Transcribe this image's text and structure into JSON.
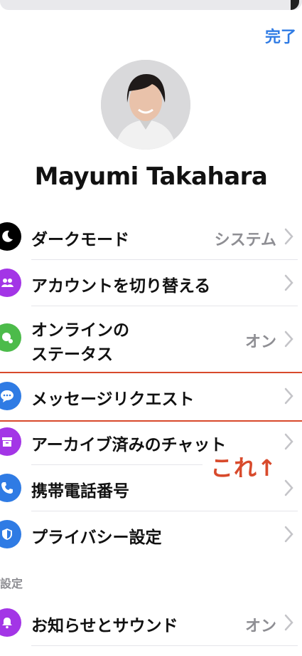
{
  "header": {
    "done_label": "完了"
  },
  "profile": {
    "name": "Mayumi Takahara"
  },
  "menu": {
    "items": [
      {
        "label": "ダークモード",
        "value": "システム",
        "icon": "moon-icon",
        "color": "#000000"
      },
      {
        "label": "アカウントを切り替える",
        "value": "",
        "icon": "switch-account-icon",
        "color": "#a335e6"
      },
      {
        "label1": "オンラインの",
        "label2": "ステータス",
        "value": "オン",
        "icon": "online-status-icon",
        "color": "#4cbb4a"
      },
      {
        "label": "メッセージリクエスト",
        "value": "",
        "icon": "message-bubble-icon",
        "color": "#2f7be4"
      },
      {
        "label": "アーカイブ済みのチャット",
        "value": "",
        "icon": "archive-icon",
        "color": "#a335e6"
      },
      {
        "label": "携帯電話番号",
        "value": "",
        "icon": "phone-icon",
        "color": "#2f7be4"
      },
      {
        "label": "プライバシー設定",
        "value": "",
        "icon": "shield-icon",
        "color": "#2f7be4"
      }
    ]
  },
  "settings": {
    "header": "設定",
    "items": [
      {
        "label": "お知らせとサウンド",
        "value": "オン",
        "icon": "bell-icon",
        "color": "#a335e6"
      }
    ]
  },
  "annotation": {
    "text": "これ↑",
    "color": "#d84a2c"
  }
}
